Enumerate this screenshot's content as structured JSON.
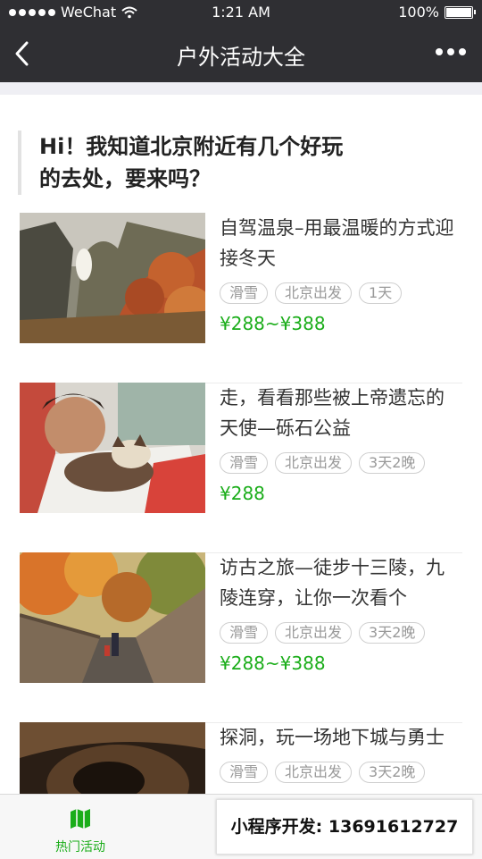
{
  "status": {
    "carrier": "WeChat",
    "time": "1:21 AM",
    "battery": "100%"
  },
  "nav": {
    "title": "户外活动大全"
  },
  "intro": {
    "line1": "Hi！我知道北京附近有几个好玩",
    "line2": "的去处，要来吗？"
  },
  "activities": [
    {
      "title": "自驾温泉–用最温暖的方式迎接冬天",
      "tags": [
        "滑雪",
        "北京出发",
        "1天"
      ],
      "price": "¥288~¥388"
    },
    {
      "title": "走，看看那些被上帝遗忘的天使—砾石公益",
      "tags": [
        "滑雪",
        "北京出发",
        "3天2晚"
      ],
      "price": "¥288"
    },
    {
      "title": "访古之旅—徒步十三陵，九陵连穿，让你一次看个",
      "tags": [
        "滑雪",
        "北京出发",
        "3天2晚"
      ],
      "price": "¥288~¥388"
    },
    {
      "title": "探洞，玩一场地下城与勇士",
      "tags": [
        "滑雪",
        "北京出发",
        "3天2晚"
      ],
      "price": ""
    }
  ],
  "tabbar": {
    "hot_label": "热门活动"
  },
  "banner": {
    "text": "小程序开发: 13691612727"
  },
  "colors": {
    "accent_green": "#1aad19",
    "nav_bg": "#2f2f33"
  },
  "icons": {
    "back": "chevron-left-icon",
    "more": "more-dots-icon",
    "wifi": "wifi-icon",
    "battery": "battery-icon",
    "map": "map-icon"
  }
}
